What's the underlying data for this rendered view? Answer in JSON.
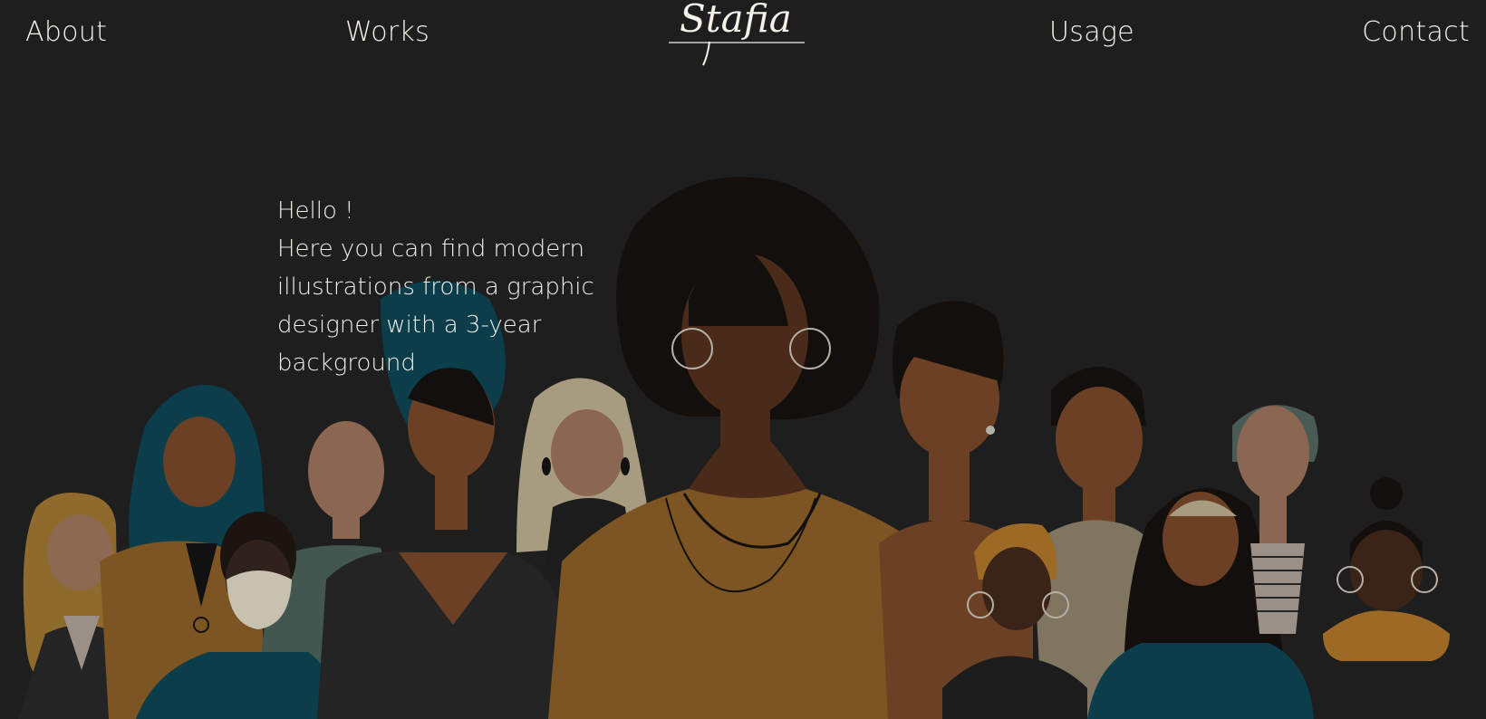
{
  "nav": {
    "about": "About",
    "works": "Works",
    "usage": "Usage",
    "contact": "Contact"
  },
  "logo": {
    "text": "Stafia"
  },
  "intro": {
    "greeting": "Hello !",
    "body": "Here you can find modern illustrations from a graphic designer with a 3-year background"
  },
  "illustration": {
    "icon": "group-of-women-illustration"
  },
  "colors": {
    "background": "#1e1e1e",
    "text": "#f4f1ea",
    "mustard": "#7d5522",
    "teal": "#0b3d4b",
    "hair_dark": "#130f0c",
    "skin_brown": "#6b4024"
  }
}
